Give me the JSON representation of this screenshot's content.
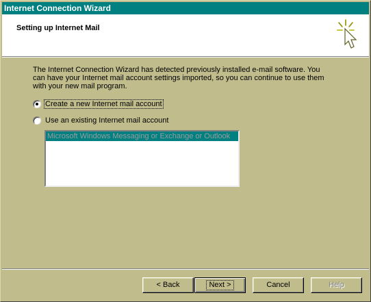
{
  "window": {
    "title": "Internet Connection Wizard"
  },
  "header": {
    "title": "Setting up Internet Mail",
    "icon": "wizard-cursor-icon"
  },
  "description": "The Internet Connection Wizard has detected previously installed e-mail software. You can have your Internet mail account settings imported, so you can continue to use them with your new mail program.",
  "options": {
    "create_new": {
      "label": "Create a new Internet mail account",
      "selected": true
    },
    "use_existing": {
      "label": "Use an existing Internet mail account",
      "selected": false
    }
  },
  "accounts_list": {
    "items": [
      "Microsoft Windows Messaging or Exchange or Outlook"
    ],
    "selected_index": 0,
    "enabled": false
  },
  "buttons": {
    "back": "< Back",
    "next": "Next >",
    "cancel": "Cancel",
    "help": "Help"
  },
  "colors": {
    "title_bar": "#008080",
    "face": "#c0bc8c",
    "selection": "#008080"
  }
}
